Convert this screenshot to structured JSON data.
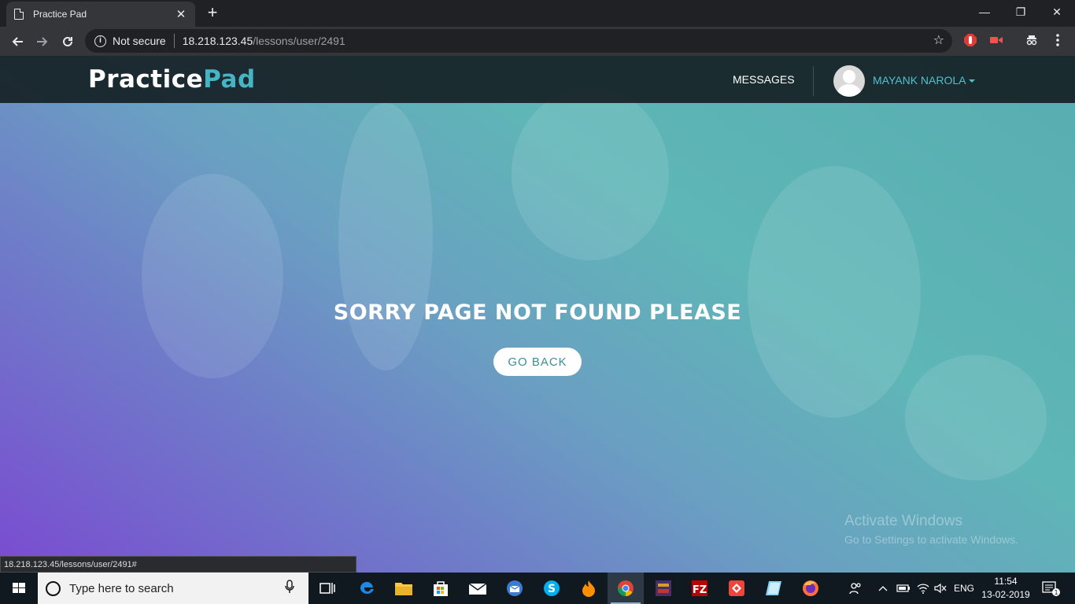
{
  "browser": {
    "tab_title": "Practice Pad",
    "tab_close": "✕",
    "new_tab": "+",
    "minimize": "—",
    "maximize": "❐",
    "close": "✕",
    "security_label": "Not secure",
    "url_host": "18.218.123.45",
    "url_path": "/lessons/user/2491"
  },
  "site": {
    "logo_part1": "Practice",
    "logo_part2": "Pad",
    "nav_messages": "MESSAGES",
    "user_name": "MAYANK NAROLA"
  },
  "main": {
    "error_message": "SORRY PAGE NOT FOUND PLEASE",
    "go_back_label": "GO BACK"
  },
  "watermark": {
    "line1": "Activate Windows",
    "line2": "Go to Settings to activate Windows."
  },
  "status_bar": {
    "url": "18.218.123.45/lessons/user/2491#"
  },
  "taskbar": {
    "search_placeholder": "Type here to search",
    "language": "ENG",
    "time": "11:54",
    "date": "13-02-2019",
    "notification_count": "1"
  },
  "colors": {
    "brand_accent": "#45b5c4",
    "header_bg": "#152126",
    "button_text": "#3c8f97"
  }
}
